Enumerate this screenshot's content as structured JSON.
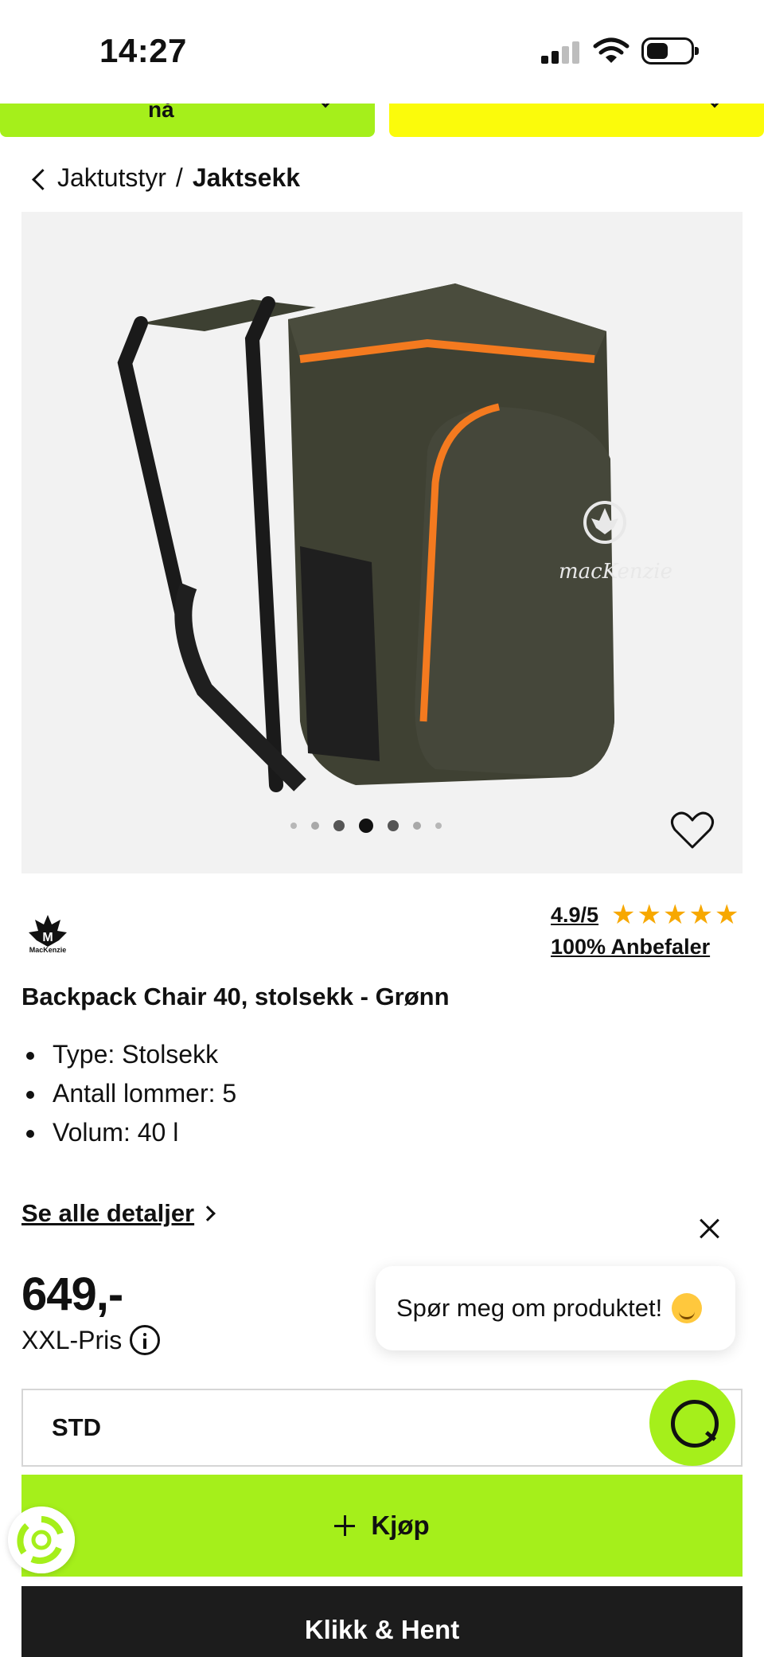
{
  "status_bar": {
    "time": "14:27"
  },
  "promo": {
    "green_text": "nå"
  },
  "breadcrumb": {
    "parent": "Jaktutstyr",
    "separator": "/",
    "current": "Jaktsekk"
  },
  "gallery": {
    "dot_count": 7,
    "active_index": 3
  },
  "brand": {
    "name": "MacKenzie",
    "logo_text": "macKenzie"
  },
  "rating": {
    "score": "4.9/5",
    "stars": 5,
    "recommend": "100% Anbefaler"
  },
  "product": {
    "title": "Backpack Chair 40, stolsekk - Grønn",
    "features": [
      "Type: Stolsekk",
      "Antall lommer: 5",
      "Volum: 40 l"
    ],
    "details_link": "Se alle detaljer"
  },
  "price": {
    "value": "649,-",
    "label": "XXL-Pris"
  },
  "chat": {
    "message": "Spør meg om produktet!"
  },
  "size": {
    "selected": "STD"
  },
  "buttons": {
    "buy": "Kjøp",
    "collect": "Klikk & Hent"
  },
  "colors": {
    "accent_green": "#a5ef1b",
    "promo_yellow": "#fbfb0b",
    "star": "#f7a800",
    "dark": "#1c1c1c"
  }
}
